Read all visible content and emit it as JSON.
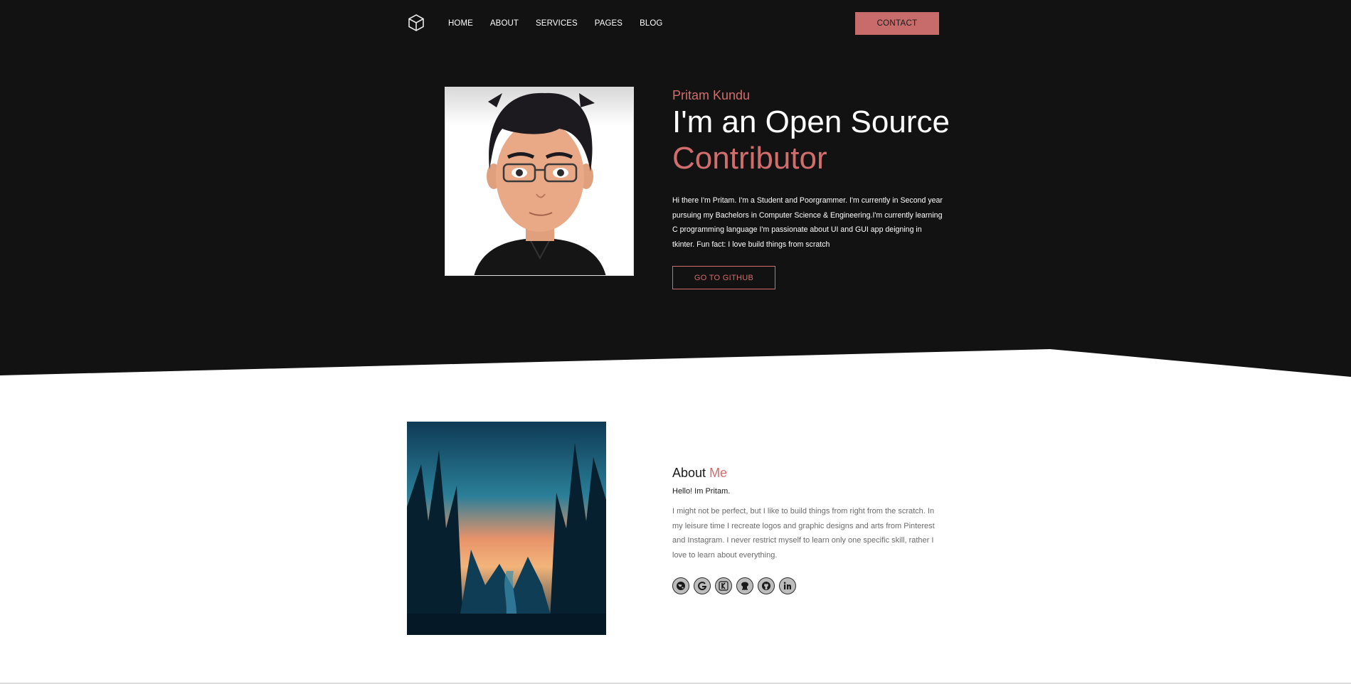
{
  "nav": {
    "logo_icon": "cube-icon",
    "items": [
      "HOME",
      "ABOUT",
      "SERVICES",
      "PAGES",
      "BLOG"
    ],
    "contact_label": "CONTACT"
  },
  "hero": {
    "name": "Pritam Kundu",
    "title_line1": "I'm an Open Source",
    "title_line2": "Contributor",
    "description": "Hi there I'm Pritam. I'm a Student and Poorgrammer. I'm currently in Second year pursuing my Bachelors in Computer Science & Engineering.I'm currently learning C programming language I'm passionate about UI and GUI app deigning in tkinter. Fun fact: I love build things from scratch",
    "github_label": "GO TO GITHUB"
  },
  "about": {
    "heading_plain": "About",
    "heading_accent": "Me",
    "hello": "Hello! Im Pritam.",
    "body": "I might not be perfect, but I like to build things from right from the scratch. In my leisure time I recreate logos and graphic designs and arts from Pinterest and Instagram. I never restrict myself to learn only one specific skill, rather I love to learn about everything.",
    "social_icons": [
      "globe-icon",
      "google-icon",
      "kaggle-icon",
      "codechef-icon",
      "github-icon",
      "linkedin-icon"
    ]
  },
  "colors": {
    "dark_bg": "#121212",
    "accent": "#d16d6d",
    "contact_bg": "#c86b6b"
  }
}
